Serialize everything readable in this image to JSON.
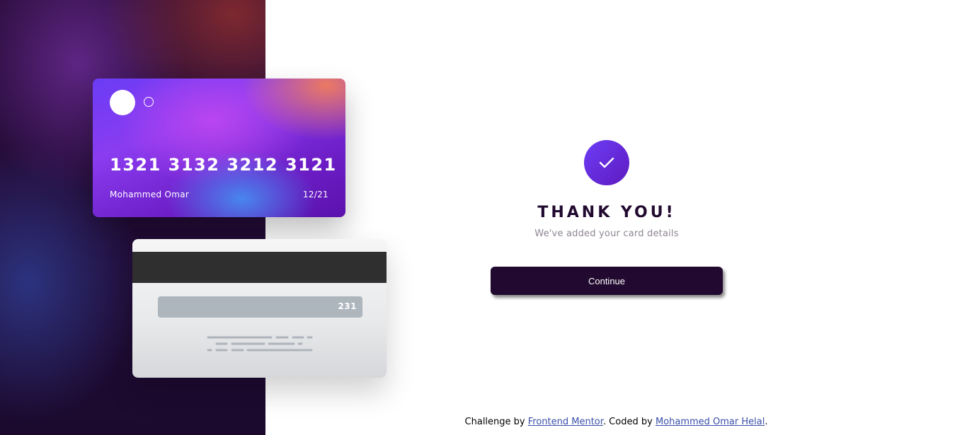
{
  "card_front": {
    "number": "1321 3132 3212 3121",
    "name": "Mohammed Omar",
    "expiry": "12/21"
  },
  "card_back": {
    "cvc": "231"
  },
  "success": {
    "title": "THANK YOU!",
    "message": "We've added your card details",
    "button_label": "Continue"
  },
  "footer": {
    "prefix": "Challenge by ",
    "link1": "Frontend Mentor",
    "middle": ". Coded by ",
    "link2": "Mohammed Omar Helal",
    "suffix": "."
  },
  "colors": {
    "accent_dark": "#21092f",
    "check_gradient_start": "#6d3df5",
    "check_gradient_end": "#5e1ac0",
    "link": "#3a4fa8"
  },
  "icons": {
    "success": "check-icon"
  }
}
